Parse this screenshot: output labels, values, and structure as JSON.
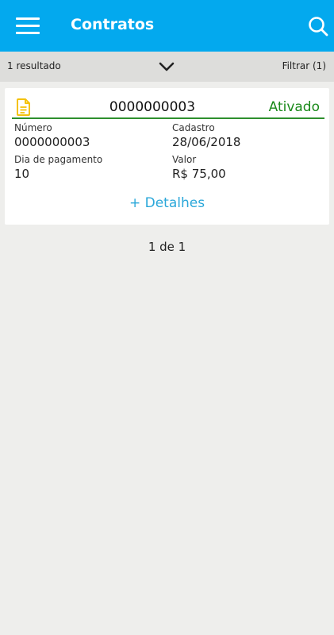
{
  "header": {
    "title": "Contratos",
    "menu_icon": "hamburger-menu-icon",
    "search_icon": "search-icon",
    "background": "#03a9ee"
  },
  "filter_bar": {
    "results": "1 resultado",
    "toggle_icon": "chevron-down-icon",
    "filter_label": "Filtrar (1)"
  },
  "contract": {
    "icon": "document-icon",
    "number_title": "0000000003",
    "status": "Ativado",
    "status_color": "#1a8a1a",
    "fields": [
      {
        "label": "Número",
        "value": "0000000003"
      },
      {
        "label": "Cadastro",
        "value": "28/06/2018"
      },
      {
        "label": "Dia de pagamento",
        "value": "10"
      },
      {
        "label": "Valor",
        "value": "R$ 75,00"
      }
    ],
    "details_link": "+ Detalhes"
  },
  "pagination": {
    "text": "1 de 1"
  }
}
